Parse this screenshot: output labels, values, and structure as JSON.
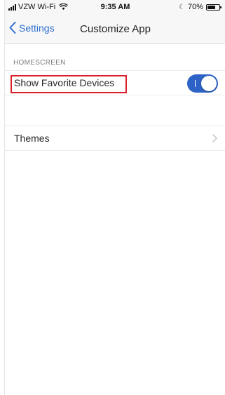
{
  "status_bar": {
    "carrier": "VZW Wi-Fi",
    "time": "9:35 AM",
    "battery_text": "70%",
    "battery_level": 0.7,
    "icons": [
      "signal-bars-icon",
      "wifi-icon",
      "moon-icon",
      "battery-icon"
    ]
  },
  "nav": {
    "back_label": "Settings",
    "title": "Customize App"
  },
  "section": {
    "header": "HOMESCREEN"
  },
  "rows": {
    "favorites": {
      "label": "Show Favorite Devices",
      "toggle_on": true,
      "toggle_glyph": "I"
    },
    "themes": {
      "label": "Themes"
    }
  },
  "colors": {
    "accent": "#2f6fd0",
    "toggle_on": "#2d63c7",
    "highlight": "#d9202a"
  }
}
